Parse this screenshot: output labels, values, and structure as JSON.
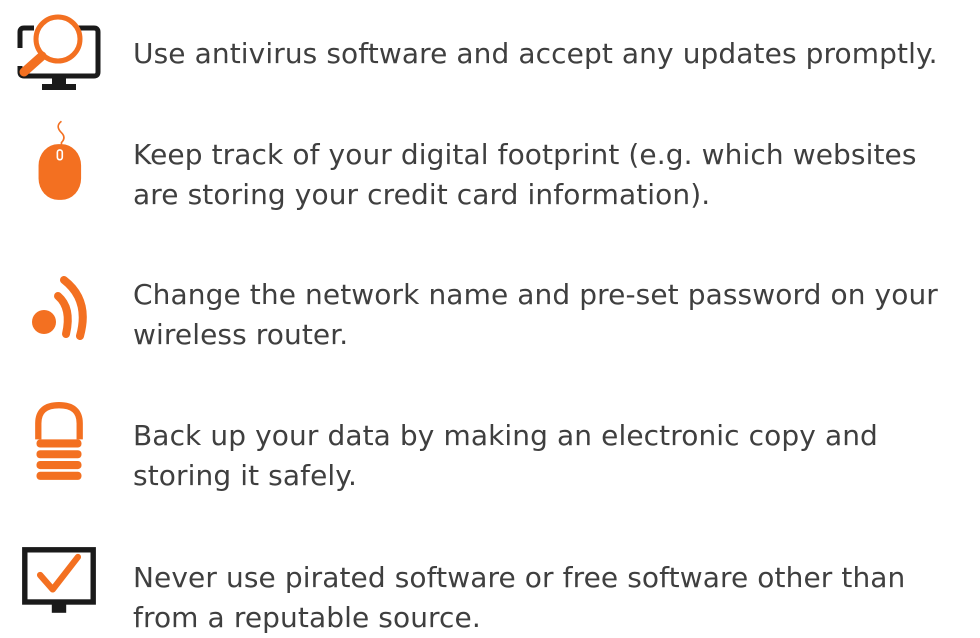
{
  "colors": {
    "accent": "#f37021",
    "icon_dark": "#1a1a1a",
    "text": "#3f3f3f"
  },
  "tips": [
    {
      "icon": "monitor-magnifier-icon",
      "text": "Use antivirus software and accept any updates promptly."
    },
    {
      "icon": "mouse-icon",
      "text": "Keep track of your digital footprint (e.g. which websites are storing your credit card information)."
    },
    {
      "icon": "wifi-signal-icon",
      "text": "Change the network name and pre-set password on your wireless router."
    },
    {
      "icon": "padlock-icon",
      "text": "Back up your data by making an electronic copy and storing it safely."
    },
    {
      "icon": "monitor-checkmark-icon",
      "text": "Never use pirated software or free software other than from a reputable source."
    }
  ]
}
